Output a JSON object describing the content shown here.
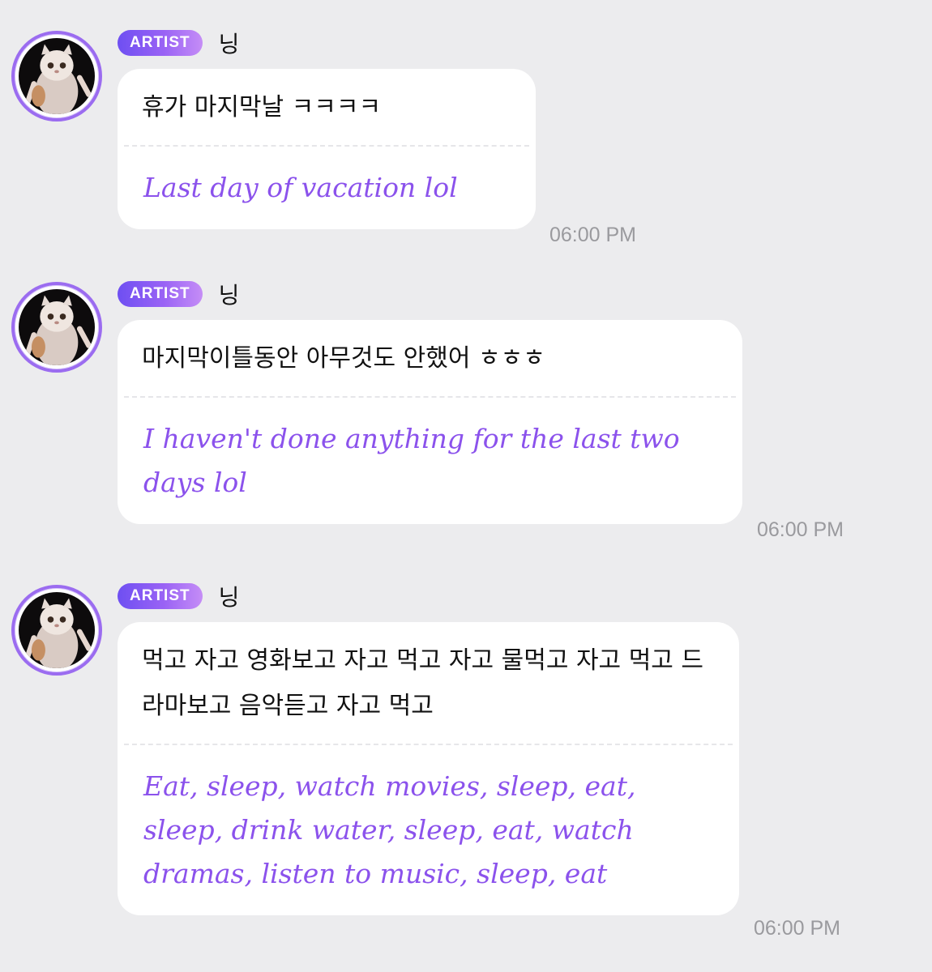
{
  "messages": [
    {
      "badge": "ARTIST",
      "sender": "닝",
      "original": "휴가 마지막날 ㅋㅋㅋㅋ",
      "translation": "Last day of vacation lol",
      "time": "06:00 PM"
    },
    {
      "badge": "ARTIST",
      "sender": "닝",
      "original": "마지막이틀동안 아무것도 안했어 ㅎㅎㅎ",
      "translation": "I haven't done anything for the last two days lol",
      "time": "06:00 PM"
    },
    {
      "badge": "ARTIST",
      "sender": "닝",
      "original": "먹고 자고 영화보고 자고 먹고 자고 물먹고 자고 먹고 드라마보고 음악듣고 자고 먹고",
      "translation": "Eat, sleep, watch movies, sleep, eat, sleep, drink water, sleep, eat, watch dramas, listen to music, sleep, eat",
      "time": "06:00 PM"
    }
  ],
  "colors": {
    "background": "#ececee",
    "badge_start": "#6e4ff2",
    "badge_end": "#c58df6",
    "translation": "#8b52ec",
    "timestamp": "#9a9a9e",
    "avatar_ring": "#9b6cf0"
  },
  "icons": {
    "avatar": "white-fluffy-cat-avatar"
  }
}
